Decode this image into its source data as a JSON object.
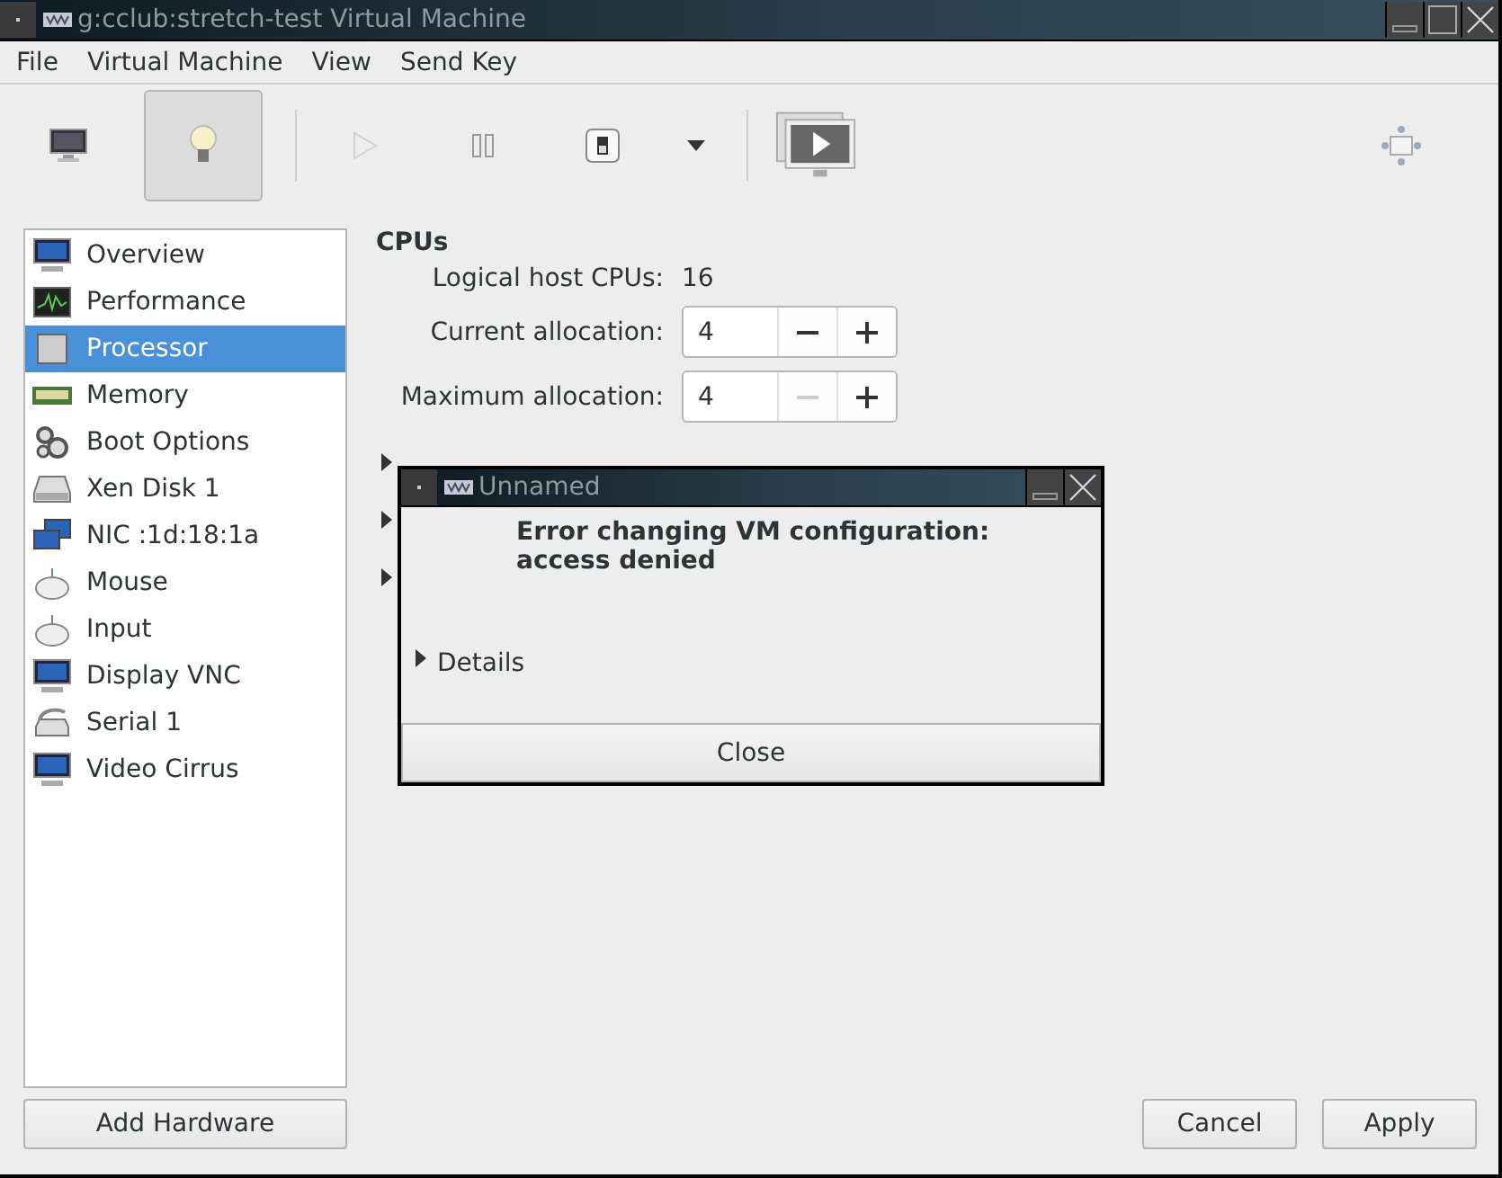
{
  "window": {
    "title": "g:cclub:stretch-test Virtual Machine"
  },
  "menu": [
    "File",
    "Virtual Machine",
    "View",
    "Send Key"
  ],
  "toolbar": [
    {
      "kind": "monitor",
      "selected": false,
      "disabled": false
    },
    {
      "kind": "bulb",
      "selected": true,
      "disabled": false
    },
    {
      "kind": "play",
      "selected": false,
      "disabled": true
    },
    {
      "kind": "pause",
      "selected": false,
      "disabled": false
    },
    {
      "kind": "power",
      "selected": false,
      "disabled": false
    },
    {
      "kind": "caret",
      "selected": false,
      "disabled": false
    },
    {
      "kind": "screens",
      "selected": false,
      "disabled": false
    },
    {
      "kind": "resize",
      "selected": false,
      "disabled": false
    }
  ],
  "sidebar": {
    "items": [
      {
        "label": "Overview",
        "kind": "monitor",
        "selected": false
      },
      {
        "label": "Performance",
        "kind": "chart",
        "selected": false
      },
      {
        "label": "Processor",
        "kind": "chip",
        "selected": true
      },
      {
        "label": "Memory",
        "kind": "ram",
        "selected": false
      },
      {
        "label": "Boot Options",
        "kind": "gears",
        "selected": false
      },
      {
        "label": "Xen Disk 1",
        "kind": "disk",
        "selected": false
      },
      {
        "label": "NIC :1d:18:1a",
        "kind": "network",
        "selected": false
      },
      {
        "label": "Mouse",
        "kind": "mouse",
        "selected": false
      },
      {
        "label": "Input",
        "kind": "mouse",
        "selected": false
      },
      {
        "label": "Display VNC",
        "kind": "monitor",
        "selected": false
      },
      {
        "label": "Serial 1",
        "kind": "serial",
        "selected": false
      },
      {
        "label": "Video Cirrus",
        "kind": "monitor",
        "selected": false
      }
    ]
  },
  "add_hardware": "Add Hardware",
  "cpus": {
    "heading": "CPUs",
    "host_label": "Logical host CPUs:",
    "host_value": "16",
    "spins": [
      {
        "label": "Current allocation:",
        "value": "4",
        "minus_disabled": false
      },
      {
        "label": "Maximum allocation:",
        "value": "4",
        "minus_disabled": true
      }
    ]
  },
  "expanders": [
    {
      "expanded": false
    },
    {
      "expanded": false
    },
    {
      "expanded": false
    }
  ],
  "buttons": [
    "Cancel",
    "Apply"
  ],
  "dialog": {
    "title": "Unnamed",
    "message": "Error changing VM configuration:\naccess denied",
    "details": {
      "label": "Details",
      "expanded": false
    },
    "button": "Close"
  }
}
